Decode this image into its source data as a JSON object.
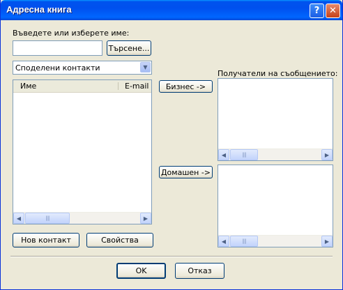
{
  "window": {
    "title": "Адресна книга",
    "help_glyph": "?",
    "close_glyph": "✕"
  },
  "search": {
    "label": "Въведете или изберете име:",
    "value": "",
    "button": "Търсене..."
  },
  "source_dropdown": {
    "selected": "Споделени контакти"
  },
  "contacts_list": {
    "columns": [
      "Име",
      "E-mail a"
    ],
    "rows": []
  },
  "actions": {
    "business": "Бизнес ->",
    "home": "Домашен ->"
  },
  "recipients": {
    "label": "Получатели на съобщението:"
  },
  "bottom_buttons": {
    "new_contact": "Нов контакт",
    "properties": "Свойства"
  },
  "dialog_buttons": {
    "ok": "OK",
    "cancel": "Отказ"
  },
  "scrollbar": {
    "left_glyph": "◀",
    "right_glyph": "▶",
    "grip": "||||",
    "down_glyph": "▼"
  }
}
